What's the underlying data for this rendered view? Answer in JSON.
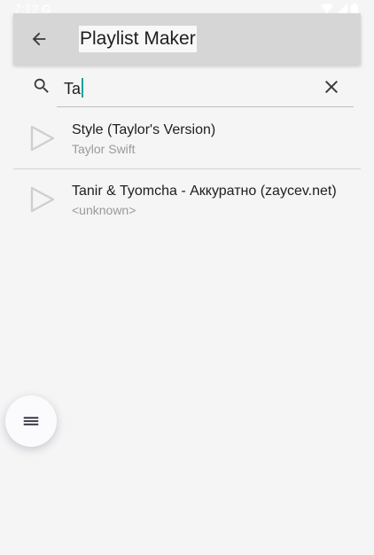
{
  "status_bar": {
    "time": "7:12",
    "google_glyph": "G",
    "icons": [
      "wifi-icon",
      "signal-icon",
      "battery-icon"
    ]
  },
  "app_bar": {
    "title": "Playlist Maker",
    "back_icon": "arrow-back-icon",
    "background": "#d6d6d6"
  },
  "search": {
    "value": "Ta",
    "icon": "search-icon",
    "clear_icon": "close-icon",
    "cursor_color": "#1aa39a"
  },
  "results": [
    {
      "title": "Style (Taylor's Version)",
      "artist": "Taylor Swift",
      "icon": "play-icon"
    },
    {
      "title": "Tanir & Tyomcha - Аккуратно (zaycev.net)",
      "artist": "<unknown>",
      "icon": "play-icon"
    }
  ],
  "fab": {
    "icon": "menu-icon"
  }
}
